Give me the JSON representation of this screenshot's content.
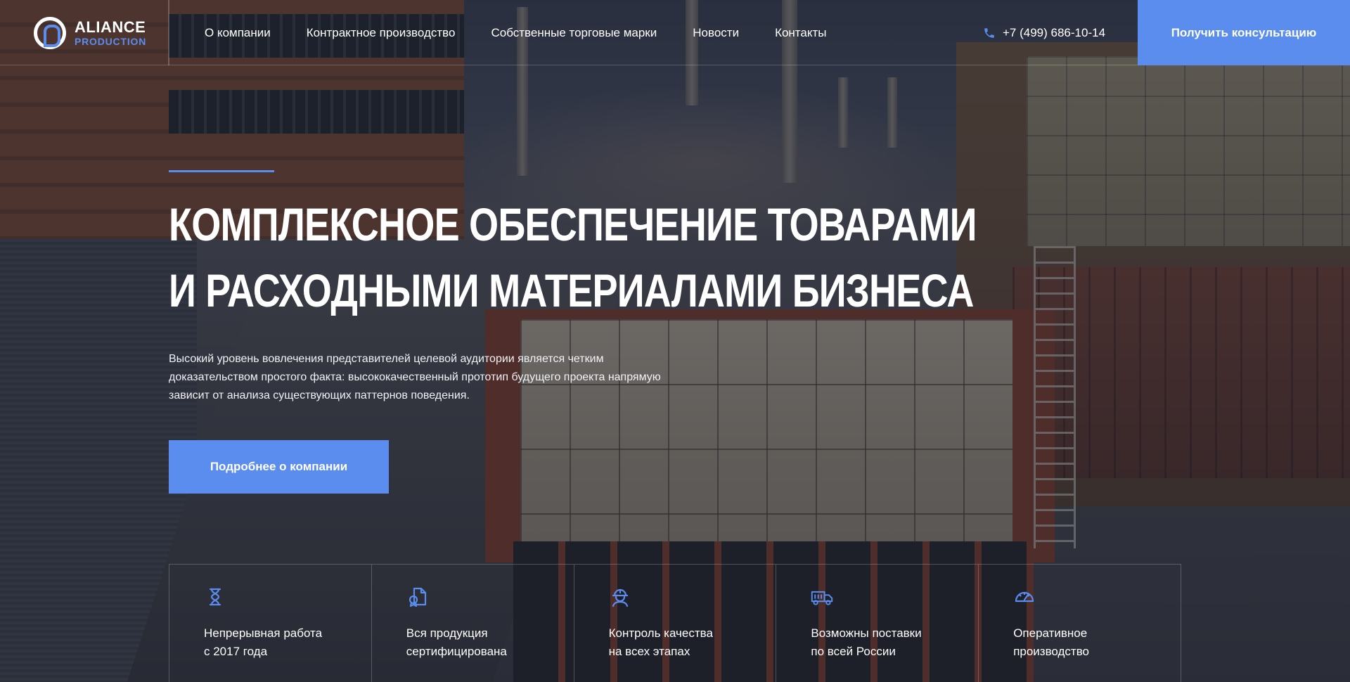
{
  "brand": {
    "line1": "ALIANCE",
    "line2": "PRODUCTION"
  },
  "nav": [
    {
      "label": "О компании"
    },
    {
      "label": "Контрактное производство"
    },
    {
      "label": "Собственные торговые марки"
    },
    {
      "label": "Новости"
    },
    {
      "label": "Контакты"
    }
  ],
  "header": {
    "phone": "+7 (499) 686-10-14",
    "cta_label": "Получить консультацию"
  },
  "hero": {
    "title_line1": "Комплексное обеспечение товарами",
    "title_line2": "и расходными материалами бизнеса",
    "description": "Высокий уровень вовлечения представителей целевой аудитории является четким доказательством простого факта: высококачественный прототип будущего проекта напрямую зависит от анализа существующих паттернов поведения.",
    "cta_label": "Подробнее о компании"
  },
  "features": [
    {
      "icon": "hourglass-icon",
      "line1": "Непрерывная работа",
      "line2": "с 2017 года"
    },
    {
      "icon": "certificate-icon",
      "line1": "Вся продукция",
      "line2": "сертифицирована"
    },
    {
      "icon": "worker-helmet-icon",
      "line1": "Контроль качества",
      "line2": "на всех этапах"
    },
    {
      "icon": "delivery-truck-icon",
      "line1": "Возможны поставки",
      "line2": "по всей России"
    },
    {
      "icon": "speedometer-icon",
      "line1": "Оперативное",
      "line2": "производство"
    }
  ],
  "colors": {
    "accent": "#5b8def",
    "overlay": "#1e2230"
  }
}
